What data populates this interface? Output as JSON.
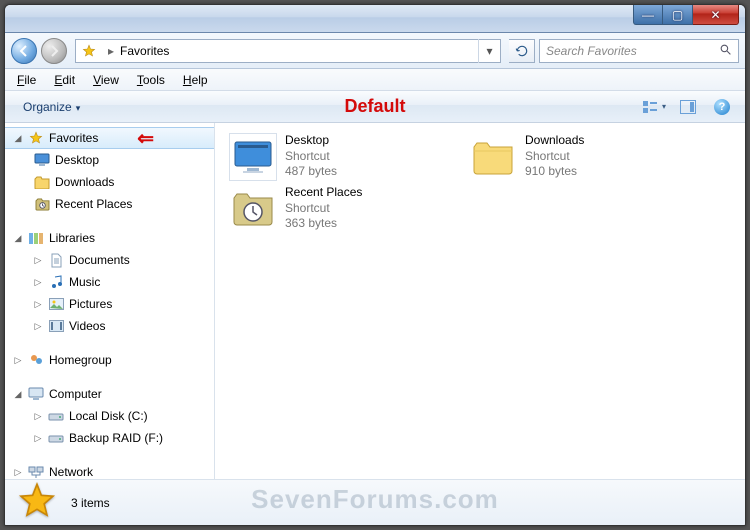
{
  "title_controls": {
    "min": "—",
    "max": "▢",
    "close": "✕"
  },
  "address": {
    "location": "Favorites",
    "chevron": "▸"
  },
  "search": {
    "placeholder": "Search Favorites"
  },
  "menubar": [
    "File",
    "Edit",
    "View",
    "Tools",
    "Help"
  ],
  "toolbar": {
    "organize": "Organize",
    "default_label": "Default"
  },
  "nav": {
    "favorites": {
      "label": "Favorites",
      "items": [
        "Desktop",
        "Downloads",
        "Recent Places"
      ]
    },
    "libraries": {
      "label": "Libraries",
      "items": [
        "Documents",
        "Music",
        "Pictures",
        "Videos"
      ]
    },
    "homegroup": {
      "label": "Homegroup"
    },
    "computer": {
      "label": "Computer",
      "items": [
        "Local Disk (C:)",
        "Backup RAID (F:)"
      ]
    },
    "network": {
      "label": "Network"
    }
  },
  "items": [
    {
      "name": "Desktop",
      "type": "Shortcut",
      "size": "487 bytes"
    },
    {
      "name": "Downloads",
      "type": "Shortcut",
      "size": "910 bytes"
    },
    {
      "name": "Recent Places",
      "type": "Shortcut",
      "size": "363 bytes"
    }
  ],
  "status": {
    "count": "3 items"
  },
  "watermark": "SevenForums.com"
}
